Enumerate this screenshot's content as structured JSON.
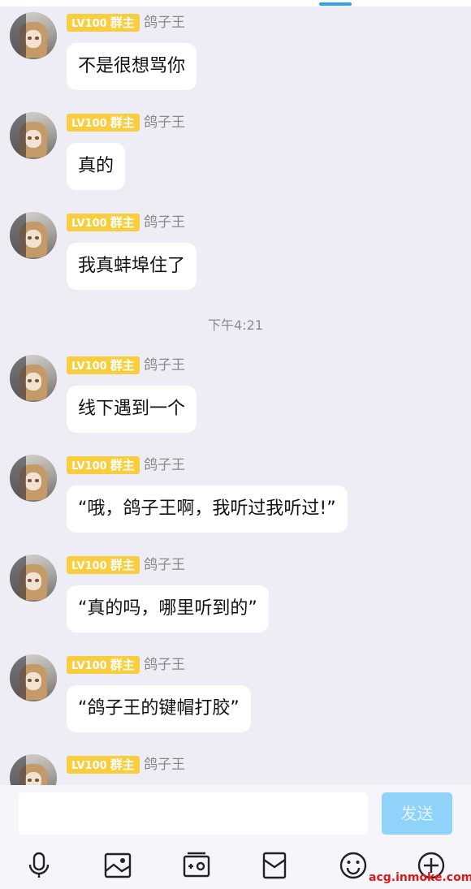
{
  "messages": [
    {
      "level": "LV100",
      "role": "群主",
      "name": "鸽子王",
      "text": "不是很想骂你"
    },
    {
      "level": "LV100",
      "role": "群主",
      "name": "鸽子王",
      "text": "真的"
    },
    {
      "level": "LV100",
      "role": "群主",
      "name": "鸽子王",
      "text": "我真蚌埠住了"
    },
    {
      "level": "LV100",
      "role": "群主",
      "name": "鸽子王",
      "text": "线下遇到一个"
    },
    {
      "level": "LV100",
      "role": "群主",
      "name": "鸽子王",
      "text": "“哦，鸽子王啊，我听过我听过!”"
    },
    {
      "level": "LV100",
      "role": "群主",
      "name": "鸽子王",
      "text": "“真的吗，哪里听到的”"
    },
    {
      "level": "LV100",
      "role": "群主",
      "name": "鸽子王",
      "text": "“鸽子王的键帽打胶”"
    },
    {
      "level": "LV100",
      "role": "群主",
      "name": "鸽子王",
      "text": ""
    }
  ],
  "time_separator": "下午4:21",
  "input": {
    "placeholder": ""
  },
  "send_label": "发送",
  "toolbar": [
    "microphone-icon",
    "picture-icon",
    "camera-icon",
    "red-packet-icon",
    "emoji-icon",
    "plus-icon"
  ],
  "watermark": "acg.inmoke.com",
  "colors": {
    "badge": "#f8cd3e",
    "send": "#8fd3fb",
    "background": "#eeedf5"
  }
}
